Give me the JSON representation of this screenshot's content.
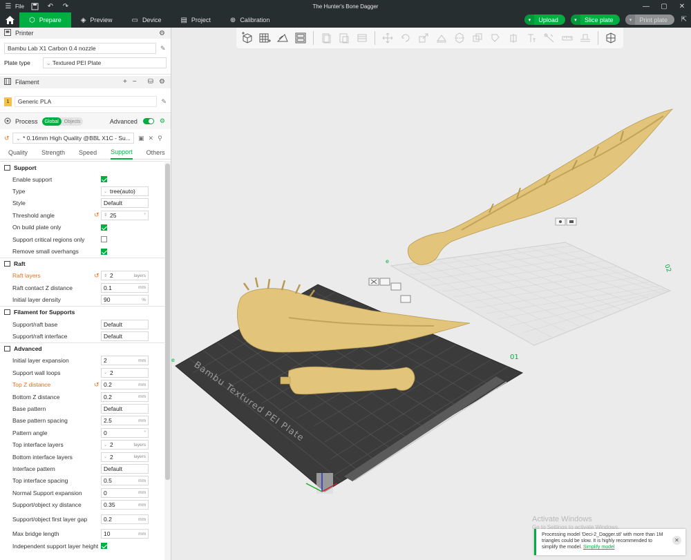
{
  "titlebar": {
    "file_label": "File",
    "title": "The Hunter's Bone Dagger"
  },
  "tabs": [
    {
      "label": "Prepare",
      "icon": "cube-icon",
      "active": true
    },
    {
      "label": "Preview",
      "icon": "layers-icon",
      "active": false
    },
    {
      "label": "Device",
      "icon": "device-icon",
      "active": false
    },
    {
      "label": "Project",
      "icon": "project-icon",
      "active": false
    },
    {
      "label": "Calibration",
      "icon": "calibration-icon",
      "active": false
    }
  ],
  "actions": {
    "upload": "Upload",
    "slice": "Slice plate",
    "print": "Print plate"
  },
  "printer": {
    "heading": "Printer",
    "model": "Bambu Lab X1 Carbon 0.4 nozzle",
    "plate_label": "Plate type",
    "plate_value": "Textured PEI Plate"
  },
  "filament": {
    "heading": "Filament",
    "index": "1",
    "name": "Generic PLA",
    "color": "#f5c242"
  },
  "process": {
    "heading": "Process",
    "global": "Global",
    "objects": "Objects",
    "advanced": "Advanced",
    "preset": "* 0.16mm High Quality @BBL X1C - Su...",
    "tabs": [
      "Quality",
      "Strength",
      "Speed",
      "Support",
      "Others"
    ],
    "active_tab": "Support"
  },
  "groups": [
    {
      "title": "Support",
      "options": [
        {
          "name": "Enable support",
          "type": "check",
          "checked": true
        },
        {
          "name": "Type",
          "type": "combo",
          "value": "tree(auto)"
        },
        {
          "name": "Style",
          "type": "field",
          "value": "Default"
        },
        {
          "name": "Threshold angle",
          "type": "spin",
          "value": "25",
          "unit": "°",
          "reset": true
        },
        {
          "name": "On build plate only",
          "type": "check",
          "checked": true
        },
        {
          "name": "Support critical regions only",
          "type": "check",
          "checked": false
        },
        {
          "name": "Remove small overhangs",
          "type": "check",
          "checked": true
        }
      ]
    },
    {
      "title": "Raft",
      "options": [
        {
          "name": "Raft layers",
          "type": "spin",
          "value": "2",
          "unit": "layers",
          "reset": true,
          "modified": true
        },
        {
          "name": "Raft contact Z distance",
          "type": "field",
          "value": "0.1",
          "unit": "mm"
        },
        {
          "name": "Initial layer density",
          "type": "field",
          "value": "90",
          "unit": "%"
        }
      ]
    },
    {
      "title": "Filament for Supports",
      "options": [
        {
          "name": "Support/raft base",
          "type": "field",
          "value": "Default"
        },
        {
          "name": "Support/raft interface",
          "type": "field",
          "value": "Default"
        }
      ]
    },
    {
      "title": "Advanced",
      "options": [
        {
          "name": "Initial layer expansion",
          "type": "field",
          "value": "2",
          "unit": "mm"
        },
        {
          "name": "Support wall loops",
          "type": "combo",
          "value": "2"
        },
        {
          "name": "Top Z distance",
          "type": "field",
          "value": "0.2",
          "unit": "mm",
          "reset": true,
          "modified": true
        },
        {
          "name": "Bottom Z distance",
          "type": "field",
          "value": "0.2",
          "unit": "mm"
        },
        {
          "name": "Base pattern",
          "type": "field",
          "value": "Default"
        },
        {
          "name": "Base pattern spacing",
          "type": "field",
          "value": "2.5",
          "unit": "mm"
        },
        {
          "name": "Pattern angle",
          "type": "field",
          "value": "0",
          "unit": "°"
        },
        {
          "name": "Top interface layers",
          "type": "combo",
          "value": "2",
          "unit": "layers"
        },
        {
          "name": "Bottom interface layers",
          "type": "combo",
          "value": "2",
          "unit": "layers"
        },
        {
          "name": "Interface pattern",
          "type": "field",
          "value": "Default"
        },
        {
          "name": "Top interface spacing",
          "type": "field",
          "value": "0.5",
          "unit": "mm"
        },
        {
          "name": "Normal Support expansion",
          "type": "field",
          "value": "0",
          "unit": "mm"
        },
        {
          "name": "Support/object xy distance",
          "type": "field",
          "value": "0.35",
          "unit": "mm"
        },
        {
          "name": "Support/object first layer gap",
          "type": "field",
          "value": "0.2",
          "unit": "mm",
          "tall": true
        },
        {
          "name": "Max bridge length",
          "type": "field",
          "value": "10",
          "unit": "mm"
        },
        {
          "name": "Independent support layer height",
          "type": "check",
          "checked": true
        }
      ]
    }
  ],
  "viewport": {
    "plate_text": "Bambu Textured PEI Plate",
    "plate1_num": "01",
    "plate2_num": "02",
    "model_color": "#e2c47a"
  },
  "watermark": {
    "line1": "Activate Windows",
    "line2": "Go to Settings to activate Windows."
  },
  "notification": {
    "text": "Processing model 'Deci-2_Dagger.stl' with more than 1M triangles could be slow. It is highly recommended to simplify the model.",
    "link": "Simplify model"
  }
}
